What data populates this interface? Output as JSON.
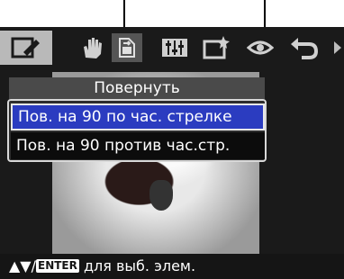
{
  "toolbar": {
    "items": [
      {
        "icon": "edit-icon"
      },
      {
        "icon": "hand-icon"
      },
      {
        "icon": "rotate-page-icon"
      },
      {
        "icon": "adjust-sliders-icon"
      },
      {
        "icon": "frame-star-icon"
      },
      {
        "icon": "red-eye-icon"
      },
      {
        "icon": "undo-icon"
      }
    ]
  },
  "dialog": {
    "title": "Повернуть",
    "options": [
      {
        "label": "Пов. на 90 по час. стрелке",
        "selected": true
      },
      {
        "label": "Пов. на 90 против час.стр.",
        "selected": false
      }
    ]
  },
  "status": {
    "arrows": "▲▼/",
    "key": "ENTER",
    "text": " для выб. элем."
  },
  "colors": {
    "selected_bg": "#2b3cc0",
    "active_tool_bg": "#b9b9b9"
  }
}
